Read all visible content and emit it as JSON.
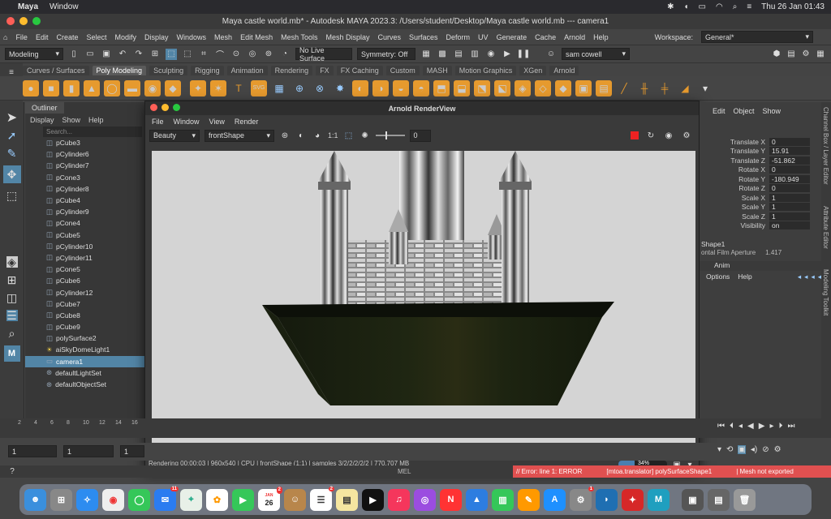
{
  "macos_menubar": {
    "apple": "",
    "app": "Maya",
    "items": [
      "Window"
    ],
    "date_time": "Thu 26 Jan  01:43"
  },
  "window_title": "Maya castle world.mb* - Autodesk MAYA 2023.3: /Users/student/Desktop/Maya castle world.mb   ---   camera1",
  "main_menu": [
    "File",
    "Edit",
    "Create",
    "Select",
    "Modify",
    "Display",
    "Windows",
    "Mesh",
    "Edit Mesh",
    "Mesh Tools",
    "Mesh Display",
    "Curves",
    "Surfaces",
    "Deform",
    "UV",
    "Generate",
    "Cache",
    "Arnold",
    "Help"
  ],
  "workspace": {
    "label": "Workspace:",
    "value": "General*"
  },
  "status_line": {
    "mode": "Modeling",
    "live_surface": "No Live Surface",
    "symmetry": "Symmetry: Off",
    "user": "sam cowell"
  },
  "shelf_tabs": [
    "Curves / Surfaces",
    "Poly Modeling",
    "Sculpting",
    "Rigging",
    "Animation",
    "Rendering",
    "FX",
    "FX Caching",
    "Custom",
    "MASH",
    "Motion Graphics",
    "XGen",
    "Arnold"
  ],
  "active_shelf_tab": "Poly Modeling",
  "outliner": {
    "title": "Outliner",
    "menu": [
      "Display",
      "Show",
      "Help"
    ],
    "search_placeholder": "Search...",
    "items": [
      "pCube3",
      "pCylinder6",
      "pCylinder7",
      "pCone3",
      "pCylinder8",
      "pCube4",
      "pCylinder9",
      "pCone4",
      "pCube5",
      "pCylinder10",
      "pCylinder11",
      "pCone5",
      "pCube6",
      "pCylinder12",
      "pCube7",
      "pCube8",
      "pCube9",
      "polySurface2",
      "aiSkyDomeLight1",
      "camera1",
      "defaultLightSet",
      "defaultObjectSet"
    ],
    "selected": "camera1"
  },
  "render_view": {
    "title": "Arnold RenderView",
    "menu": [
      "File",
      "Window",
      "View",
      "Render"
    ],
    "aov": "Beauty",
    "camera": "frontShape",
    "ratio": "1:1",
    "exposure": "0",
    "status": "Rendering 00:00:03  |  960x540  |  CPU  |  frontShape (1:1)  |  samples 3/2/2/2/2/2  |  770.707 MB",
    "progress": "34%",
    "progress_value": 0.34
  },
  "channel_box": {
    "menu": [
      "Edit",
      "Object",
      "Show"
    ],
    "attributes": [
      {
        "label": "Translate X",
        "value": "0"
      },
      {
        "label": "Translate Y",
        "value": "15.91"
      },
      {
        "label": "Translate Z",
        "value": "-51.862"
      },
      {
        "label": "Rotate X",
        "value": "0"
      },
      {
        "label": "Rotate Y",
        "value": "-180.949"
      },
      {
        "label": "Rotate Z",
        "value": "0"
      },
      {
        "label": "Scale X",
        "value": "1"
      },
      {
        "label": "Scale Y",
        "value": "1"
      },
      {
        "label": "Scale Z",
        "value": "1"
      },
      {
        "label": "Visibility",
        "value": "on"
      }
    ],
    "shape": "Shape1",
    "shape_attr": "ontal Film Aperture",
    "shape_attr_value": "1.417",
    "layer_tab": "Anim",
    "layer_menu": [
      "Options",
      "Help"
    ]
  },
  "side_tabs": [
    "Channel Box / Layer Editor",
    "Attribute Editor",
    "Modeling Toolkit"
  ],
  "timeline": {
    "ticks": [
      "2",
      "4",
      "6",
      "8",
      "10",
      "12",
      "14",
      "16"
    ]
  },
  "range": {
    "start": "1",
    "current": "1",
    "frame": "1"
  },
  "command_line": {
    "label": "MEL",
    "error": "// Error: line 1: ERROR",
    "error2": "[mtoa.translator]  polySurfaceShape1",
    "error3": "| Mesh not exported"
  },
  "dock": {
    "badges": {
      "mail": "11",
      "calendar": "2",
      "reminders": "2",
      "settings": "1"
    },
    "calendar_month": "JAN",
    "calendar_day": "26"
  },
  "colors": {
    "accent": "#5285a6",
    "render_bg": "#d4d4d4",
    "ground": "#1e2414",
    "error": "#e05050"
  }
}
